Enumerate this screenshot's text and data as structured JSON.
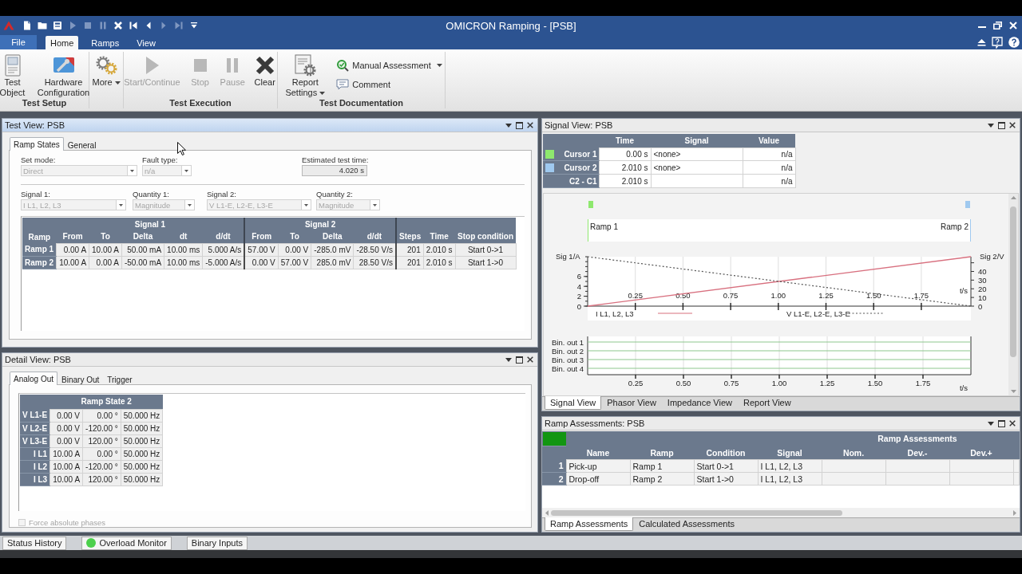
{
  "title_bar": {
    "title": "OMICRON Ramping - [PSB]",
    "quick_access": [
      {
        "disabled": false
      },
      {
        "disabled": false
      },
      {
        "disabled": false
      },
      {
        "disabled": true
      },
      {
        "disabled": true
      },
      {
        "disabled": true
      },
      {
        "disabled": false
      },
      {
        "disabled": false
      },
      {
        "disabled": false
      },
      {
        "disabled": true
      },
      {
        "disabled": true
      },
      {
        "disabled": false
      }
    ]
  },
  "ribbon_tabs": [
    {
      "label": "File",
      "kind": "file",
      "selected": false
    },
    {
      "label": "Home",
      "kind": "tab",
      "selected": true
    },
    {
      "label": "Ramps",
      "kind": "tab",
      "selected": false
    },
    {
      "label": "View",
      "kind": "tab",
      "selected": false
    }
  ],
  "ribbon_groups": [
    {
      "label": "Test Setup",
      "buttons": [
        {
          "label": "Test Object",
          "kind": "large",
          "disabled": false
        },
        {
          "label": "Hardware Configuration",
          "kind": "large",
          "disabled": false
        }
      ]
    },
    {
      "buttons": [
        {
          "label": "More",
          "kind": "large-menu",
          "disabled": false
        }
      ]
    },
    {
      "label": "Test Execution",
      "buttons": [
        {
          "label": "Start/Continue",
          "kind": "large",
          "disabled": true
        },
        {
          "label": "Stop",
          "kind": "large",
          "disabled": true
        },
        {
          "label": "Pause",
          "kind": "large",
          "disabled": true
        },
        {
          "label": "Clear",
          "kind": "large",
          "disabled": false
        }
      ]
    },
    {
      "label": "Test Documentation",
      "buttons": [
        {
          "label": "Report Settings",
          "kind": "large-menu",
          "disabled": false
        },
        {
          "label": "Manual Assessment",
          "kind": "small-menu",
          "disabled": false
        },
        {
          "label": "Comment",
          "kind": "small",
          "disabled": false
        }
      ]
    }
  ],
  "test_view": {
    "title": "Test View: PSB",
    "active": true,
    "tabs": [
      {
        "label": "Ramp States",
        "selected": true
      },
      {
        "label": "General",
        "selected": false
      }
    ],
    "settings_row": [
      {
        "label": "Set mode:",
        "value": "Direct",
        "kind": "dropdown",
        "disabled": true
      },
      {
        "label": "Fault type:",
        "value": "n/a",
        "kind": "dropdown",
        "disabled": true
      },
      {
        "label": "Estimated test time:",
        "value": "4.020 s",
        "kind": "readout"
      }
    ],
    "signal_row": [
      {
        "label": "Signal 1:",
        "value": "I L1, L2, L3",
        "kind": "dropdown",
        "disabled": true
      },
      {
        "label": "Quantity 1:",
        "value": "Magnitude",
        "kind": "dropdown",
        "disabled": true
      },
      {
        "label": "Signal 2:",
        "value": "V L1-E, L2-E, L3-E",
        "kind": "dropdown",
        "disabled": true
      },
      {
        "label": "Quantity 2:",
        "value": "Magnitude",
        "kind": "dropdown",
        "disabled": true
      }
    ],
    "ramp_table": {
      "corner": "Ramp",
      "groups": [
        {
          "label": "Signal 1",
          "columns": [
            "From",
            "To",
            "Delta",
            "dt",
            "d/dt"
          ]
        },
        {
          "label": "Signal 2",
          "columns": [
            "From",
            "To",
            "Delta",
            "d/dt"
          ]
        },
        {
          "columns": [
            "Steps",
            "Time",
            "Stop condition"
          ]
        }
      ],
      "rows": [
        {
          "label": "Ramp 1",
          "cells": [
            "0.00 A",
            "10.00 A",
            "50.00 mA",
            "10.00 ms",
            "5.000 A/s",
            "57.00 V",
            "0.00 V",
            "-285.0 mV",
            "-28.50 V/s",
            "201",
            "2.010 s",
            "Start 0->1"
          ]
        },
        {
          "label": "Ramp 2",
          "cells": [
            "10.00 A",
            "0.00 A",
            "-50.00 mA",
            "10.00 ms",
            "-5.000 A/s",
            "0.00 V",
            "57.00 V",
            "285.0 mV",
            "28.50 V/s",
            "201",
            "2.010 s",
            "Start 1->0"
          ]
        }
      ]
    }
  },
  "detail_view": {
    "title": "Detail View: PSB",
    "active": false,
    "tabs": [
      {
        "label": "Analog Out",
        "selected": true
      },
      {
        "label": "Binary Out",
        "selected": false
      },
      {
        "label": "Trigger",
        "selected": false
      }
    ],
    "table": {
      "title": "Ramp State 2",
      "rows": [
        {
          "label": "V L1-E",
          "cells": [
            "0.00 V",
            "0.00 °",
            "50.000 Hz"
          ]
        },
        {
          "label": "V L2-E",
          "cells": [
            "0.00 V",
            "-120.00 °",
            "50.000 Hz"
          ]
        },
        {
          "label": "V L3-E",
          "cells": [
            "0.00 V",
            "120.00 °",
            "50.000 Hz"
          ]
        },
        {
          "label": "I L1",
          "cells": [
            "10.00 A",
            "0.00 °",
            "50.000 Hz"
          ]
        },
        {
          "label": "I L2",
          "cells": [
            "10.00 A",
            "-120.00 °",
            "50.000 Hz"
          ]
        },
        {
          "label": "I L3",
          "cells": [
            "10.00 A",
            "120.00 °",
            "50.000 Hz"
          ]
        }
      ]
    },
    "checkbox": {
      "label": "Force absolute phases",
      "checked": false,
      "disabled": true
    }
  },
  "signal_view": {
    "title": "Signal View: PSB",
    "active": false,
    "cursor_table": {
      "columns": [
        "Time",
        "Signal",
        "Value"
      ],
      "rows": [
        {
          "label": "Cursor 1",
          "color": "#8ee86e",
          "time": "0.00 s",
          "signal": "<none>",
          "value": "n/a"
        },
        {
          "label": "Cursor 2",
          "color": "#9fc9ef",
          "time": "2.010 s",
          "signal": "<none>",
          "value": "n/a"
        },
        {
          "label": "C2 - C1",
          "time": "2.010 s",
          "value": "n/a"
        }
      ]
    },
    "ramp_markers": [
      "Ramp 1",
      "Ramp 2"
    ],
    "chart_data": [
      {
        "type": "line",
        "xlabel": "t/s",
        "ylabel": "Sig 1/A",
        "y2label": "Sig 2/V",
        "xlim": [
          0,
          2.01
        ],
        "ylim": [
          0,
          10
        ],
        "y2lim": [
          0,
          57
        ],
        "xticks": [
          0.25,
          {
            "value": 0.5,
            "label": "0.50"
          },
          0.75,
          {
            "value": 1,
            "label": "1.00"
          },
          1.25,
          {
            "value": 1.5,
            "label": "1.50"
          },
          1.75
        ],
        "yticks": [
          0,
          2,
          4,
          6
        ],
        "y2ticks": [
          0,
          10,
          20,
          30,
          40
        ],
        "grid": true,
        "legend": "bottom",
        "x": [
          0,
          2.01
        ],
        "series": [
          {
            "name": "I L1, L2, L3",
            "color": "#d8707f",
            "values": [
              0,
              10
            ]
          },
          {
            "name": "V L1-E, L2-E, L3-E",
            "color": "#555555",
            "axis": "y2",
            "line_style": "dotted",
            "values": [
              57,
              0
            ]
          }
        ]
      }
    ],
    "binary_outputs": {
      "lanes": [
        "Bin. out 1",
        "Bin. out 2",
        "Bin. out 3",
        "Bin. out 4"
      ],
      "ticks": [
        "0.25",
        "0.50",
        "0.75",
        "1.00",
        "1.25",
        "1.50",
        "1.75"
      ],
      "xlabel": "t/s"
    },
    "tabs": [
      {
        "label": "Signal View",
        "selected": true
      },
      {
        "label": "Phasor View",
        "selected": false
      },
      {
        "label": "Impedance View",
        "selected": false
      },
      {
        "label": "Report View",
        "selected": false
      }
    ]
  },
  "ramp_assessments": {
    "title": "Ramp Assessments: PSB",
    "active": false,
    "passed": true,
    "group_header": "Ramp Assessments",
    "columns": [
      "Name",
      "Ramp",
      "Condition",
      "Signal",
      "Nom.",
      "Dev.-",
      "Dev.+"
    ],
    "rows": [
      {
        "index": "1",
        "cells": [
          "Pick-up",
          "Ramp 1",
          "Start 0->1",
          "I L1, L2, L3"
        ]
      },
      {
        "index": "2",
        "cells": [
          "Drop-off",
          "Ramp 2",
          "Start 1->0",
          "I L1, L2, L3"
        ]
      }
    ],
    "tabs": [
      {
        "label": "Ramp Assessments",
        "selected": true
      },
      {
        "label": "Calculated Assessments",
        "selected": false
      }
    ]
  },
  "dock_tabs": [
    {
      "label": "Status History"
    },
    {
      "label": "Overload Monitor",
      "color": "#4cd04c"
    },
    {
      "label": "Binary Inputs"
    }
  ]
}
